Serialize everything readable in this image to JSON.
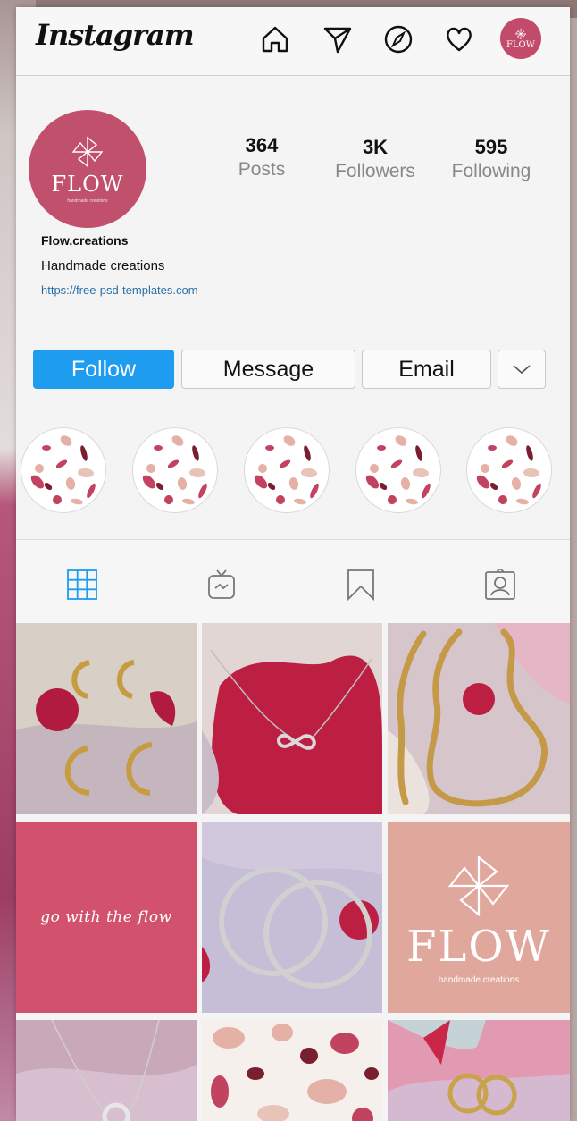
{
  "app": {
    "title": "Instagram"
  },
  "nav": {
    "icons": [
      "home-icon",
      "send-icon",
      "explore-icon",
      "heart-icon"
    ],
    "avatar_text": "FLOW"
  },
  "profile": {
    "avatar_brand": "FLOW",
    "avatar_tagline": "handmade creations",
    "username": "Flow.creations",
    "bio": "Handmade creations",
    "link": "https://free-psd-templates.com",
    "stats": [
      {
        "value": "364",
        "label": "Posts"
      },
      {
        "value": "3K",
        "label": "Followers"
      },
      {
        "value": "595",
        "label": "Following"
      }
    ]
  },
  "actions": {
    "follow_label": "Follow",
    "message_label": "Message",
    "email_label": "Email",
    "dropdown_icon": "chevron-down-icon"
  },
  "highlights_count": 5,
  "tabs": [
    "grid-icon",
    "igtv-icon",
    "saved-icon",
    "tagged-icon"
  ],
  "posts": [
    {
      "subject": "gold hoop earrings"
    },
    {
      "subject": "infinity necklace"
    },
    {
      "subject": "gold snake chain"
    },
    {
      "caption": "go with the flow"
    },
    {
      "subject": "silver hoop earrings"
    },
    {
      "brand": "FLOW",
      "tagline": "handmade creations"
    },
    {
      "subject": "silver circle necklace"
    },
    {
      "subject": "terrazzo pattern"
    },
    {
      "subject": "gold huggie earrings"
    }
  ],
  "colors": {
    "accent": "#1d9cf0",
    "brand": "#c24a6a",
    "link": "#2b6fa8"
  }
}
